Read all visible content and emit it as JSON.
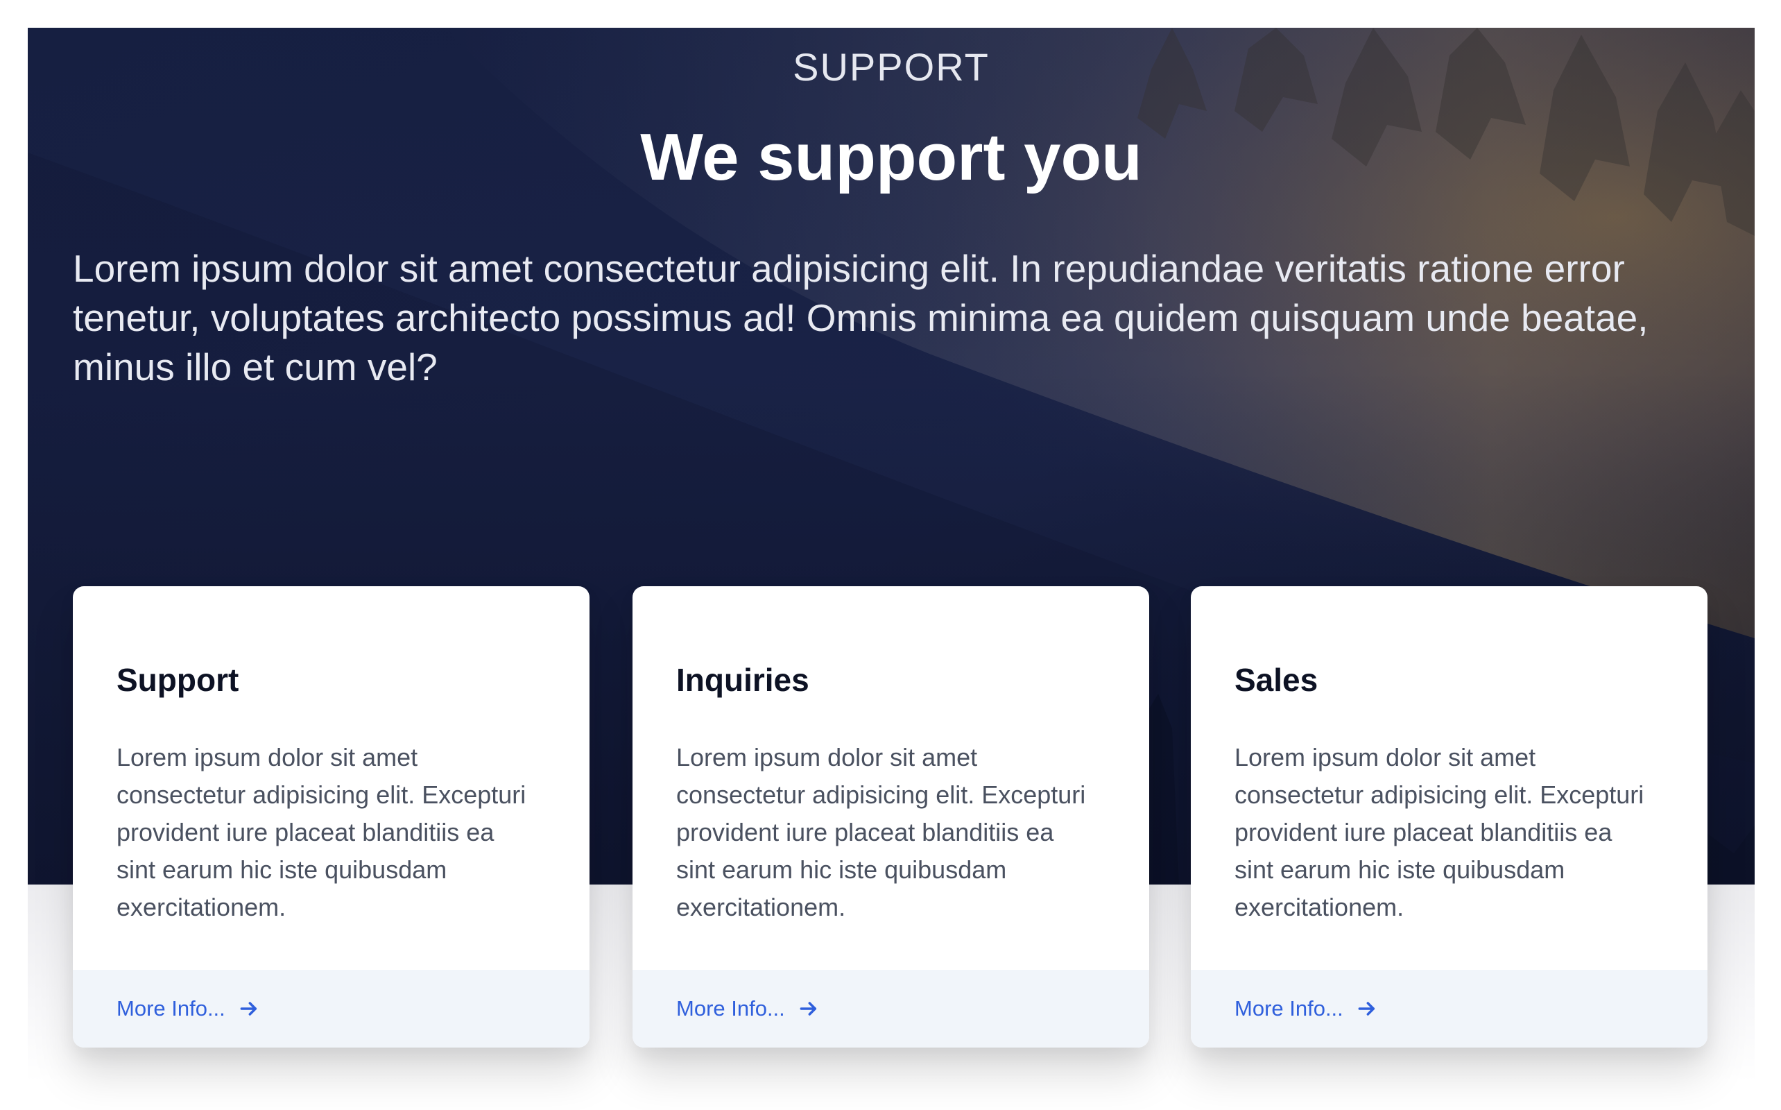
{
  "hero": {
    "eyebrow": "SUPPORT",
    "headline": "We support you",
    "intro": "Lorem ipsum dolor sit amet consectetur adipisicing elit. In repudiandae veritatis ratione error tenetur, voluptates architecto possimus ad! Omnis minima ea quidem quisquam unde beatae, minus illo et cum vel?"
  },
  "cards": [
    {
      "title": "Support",
      "text": "Lorem ipsum dolor sit amet consectetur adipisicing elit. Excepturi provident iure placeat blanditiis ea sint earum hic iste quibusdam exercitationem.",
      "link_label": "More Info...",
      "link_icon": "arrow-right-icon"
    },
    {
      "title": "Inquiries",
      "text": "Lorem ipsum dolor sit amet consectetur adipisicing elit. Excepturi provident iure placeat blanditiis ea sint earum hic iste quibusdam exercitationem.",
      "link_label": "More Info...",
      "link_icon": "arrow-right-icon"
    },
    {
      "title": "Sales",
      "text": "Lorem ipsum dolor sit amet consectetur adipisicing elit. Excepturi provident iure placeat blanditiis ea sint earum hic iste quibusdam exercitationem.",
      "link_label": "More Info...",
      "link_icon": "arrow-right-icon"
    }
  ],
  "colors": {
    "hero_background": "#141c3a",
    "link": "#2f5fdc",
    "card_footer": "#f1f5fa"
  }
}
